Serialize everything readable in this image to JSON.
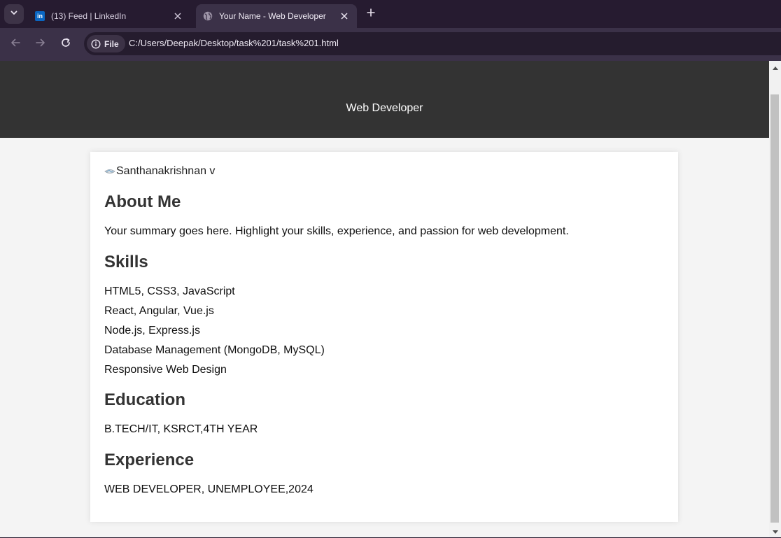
{
  "browser": {
    "tabs": [
      {
        "title": "(13) Feed | LinkedIn",
        "favicon": "linkedin-icon",
        "favicon_text": "in",
        "active": false
      },
      {
        "title": "Your Name - Web Developer",
        "favicon": "globe-icon",
        "active": true
      }
    ],
    "address": {
      "chip_label": "File",
      "url": "C:/Users/Deepak/Desktop/task%201/task%201.html"
    }
  },
  "page": {
    "header": {
      "role": "Web Developer"
    },
    "profile": {
      "image_alt": "Santhanakrishnan v"
    },
    "about": {
      "heading": "About Me",
      "summary": "Your summary goes here. Highlight your skills, experience, and passion for web development."
    },
    "skills": {
      "heading": "Skills",
      "items": [
        "HTML5, CSS3, JavaScript",
        "React, Angular, Vue.js",
        "Node.js, Express.js",
        "Database Management (MongoDB, MySQL)",
        "Responsive Web Design"
      ]
    },
    "education": {
      "heading": "Education",
      "text": "B.TECH/IT, KSRCT,4TH YEAR"
    },
    "experience": {
      "heading": "Experience",
      "text": "WEB DEVELOPER, UNEMPLOYEE,2024"
    }
  },
  "colors": {
    "chrome_tabbar": "#261b30",
    "chrome_toolbar": "#3b3148",
    "header_bg": "#333333",
    "page_bg": "#f4f4f4",
    "card_bg": "#ffffff",
    "linkedin_blue": "#0a66c2"
  }
}
